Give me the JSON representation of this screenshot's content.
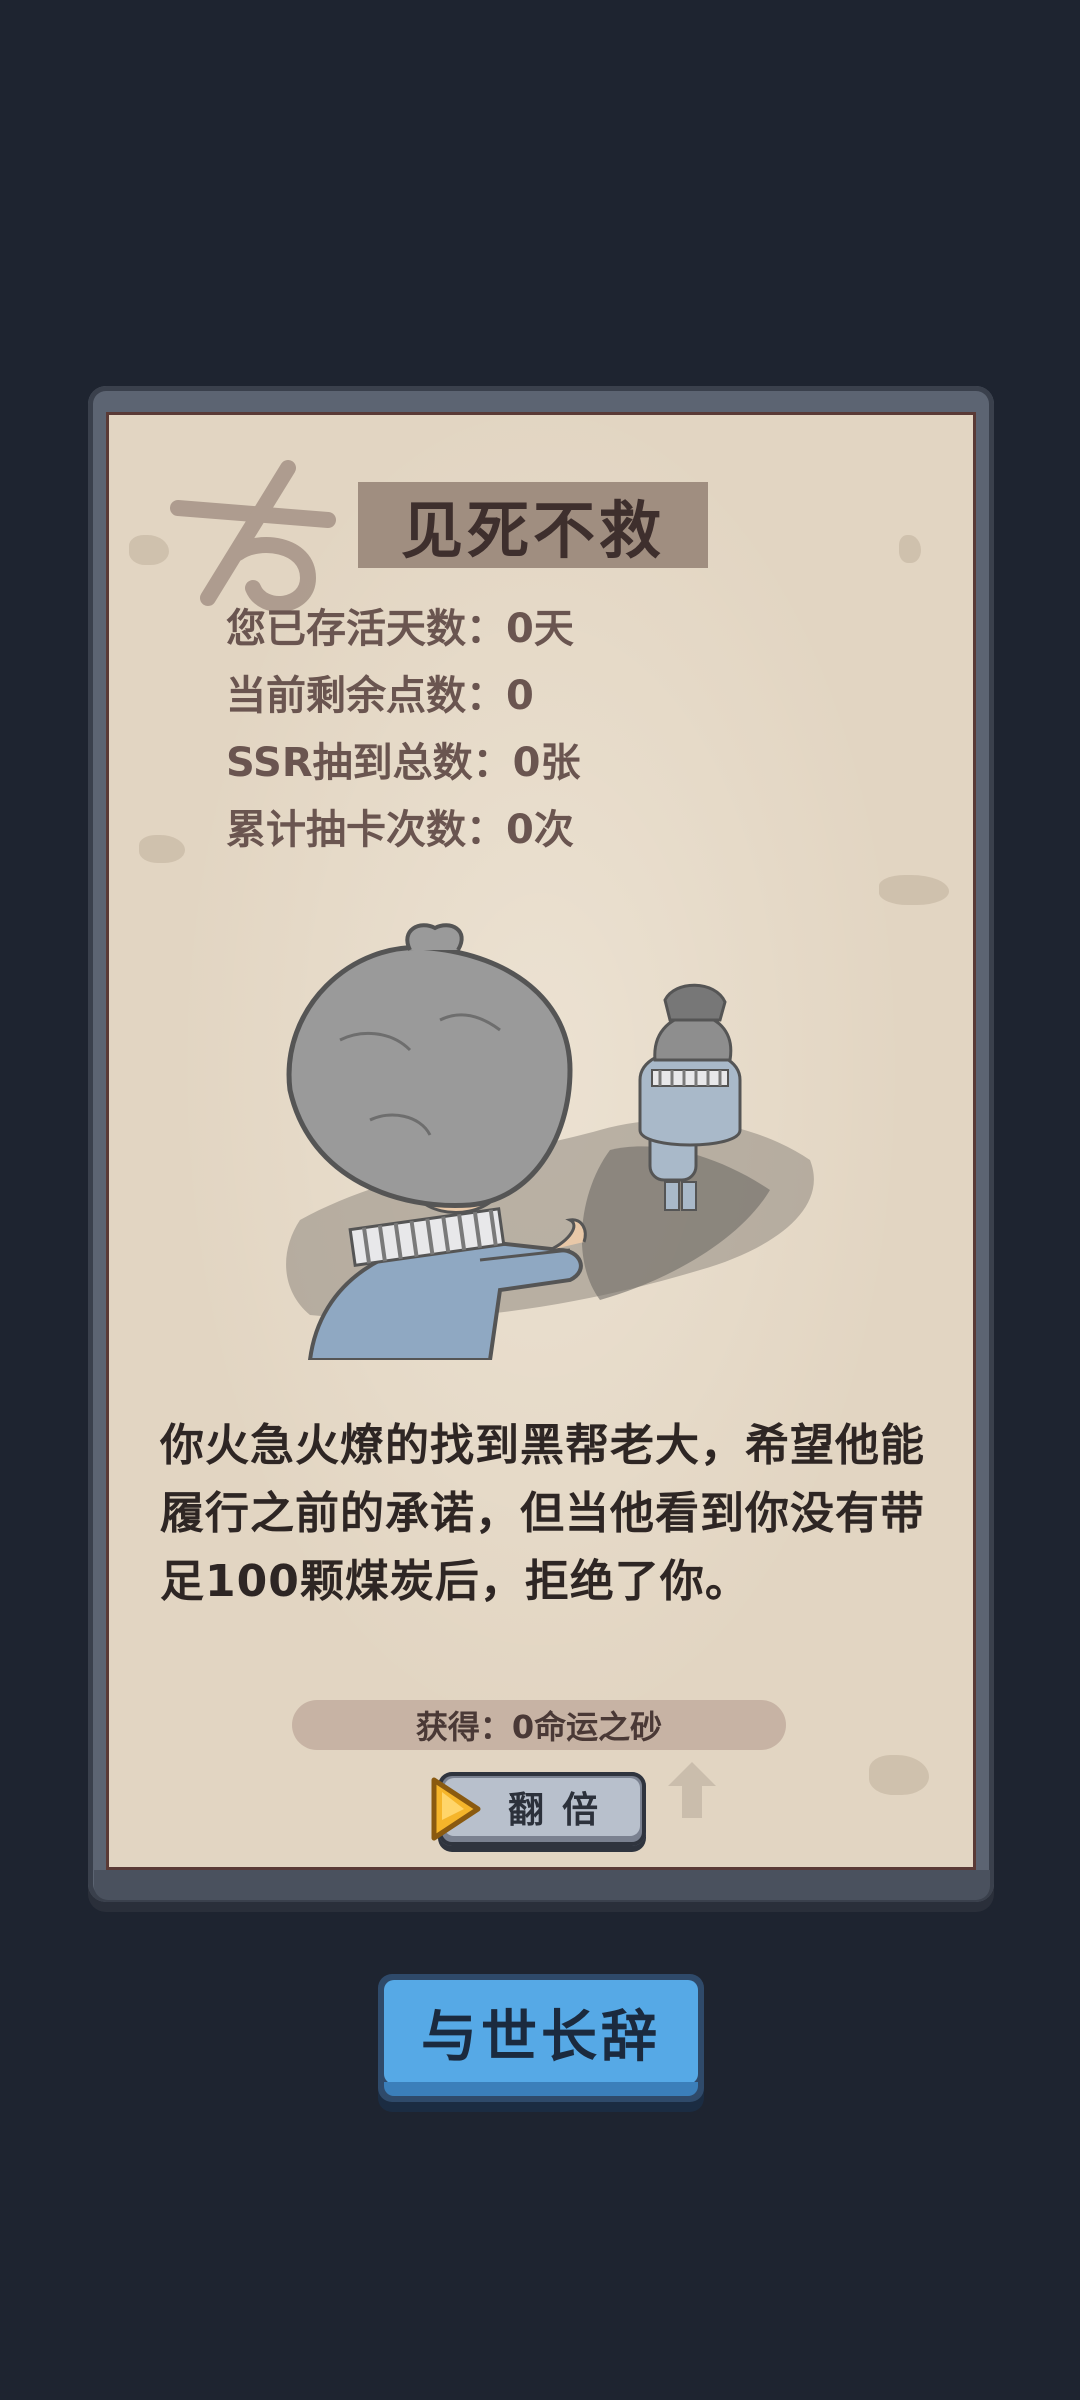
{
  "card": {
    "title": "见死不救",
    "stats": {
      "days": "您已存活天数：0天",
      "points": "当前剩余点数：0",
      "ssr": "SSR抽到总数：0张",
      "draws": "累计抽卡次数：0次"
    },
    "story": "你火急火燎的找到黑帮老大，希望他能履行之前的承诺，但当他看到你没有带足100颗煤炭后，拒绝了你。",
    "reward": "获得：0命运之砂",
    "double_label": "翻倍"
  },
  "main_button": {
    "label": "与世长辞"
  },
  "colors": {
    "background": "#1e2430",
    "paper": "#e2d5c2",
    "frame": "#5c6472",
    "main_button": "#56a9e6",
    "play_icon": "#f5b52a"
  },
  "icons": [
    "stamp-icon",
    "play-icon",
    "arrow-up-icon"
  ]
}
